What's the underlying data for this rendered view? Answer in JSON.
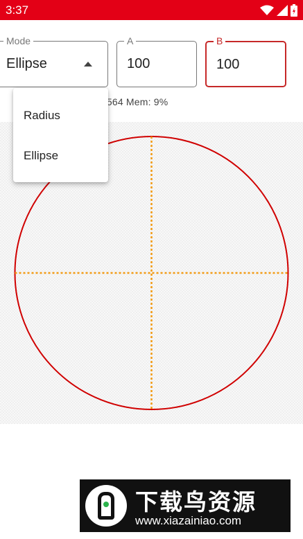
{
  "status_bar": {
    "time": "3:37",
    "icons": [
      "wifi-icon",
      "signal-icon",
      "battery-icon"
    ],
    "background": "#e30016"
  },
  "controls": {
    "mode": {
      "label": "Mode",
      "value": "Ellipse"
    },
    "a": {
      "label": "A",
      "value": "100"
    },
    "b": {
      "label": "B",
      "value": "100"
    }
  },
  "info": {
    "text": "0x100 Blocks: 564 Mem: 9%"
  },
  "dropdown": {
    "items": [
      "Radius",
      "Ellipse"
    ]
  },
  "canvas": {
    "shape": "ellipse",
    "a": 100,
    "b": 100,
    "outline_color": "#d00000",
    "axis_color": "#f29a12"
  },
  "watermark": {
    "title": "下载鸟资源",
    "url": "www.xiazainiao.com"
  },
  "colors": {
    "accent": "#c62828",
    "status": "#e30016"
  }
}
